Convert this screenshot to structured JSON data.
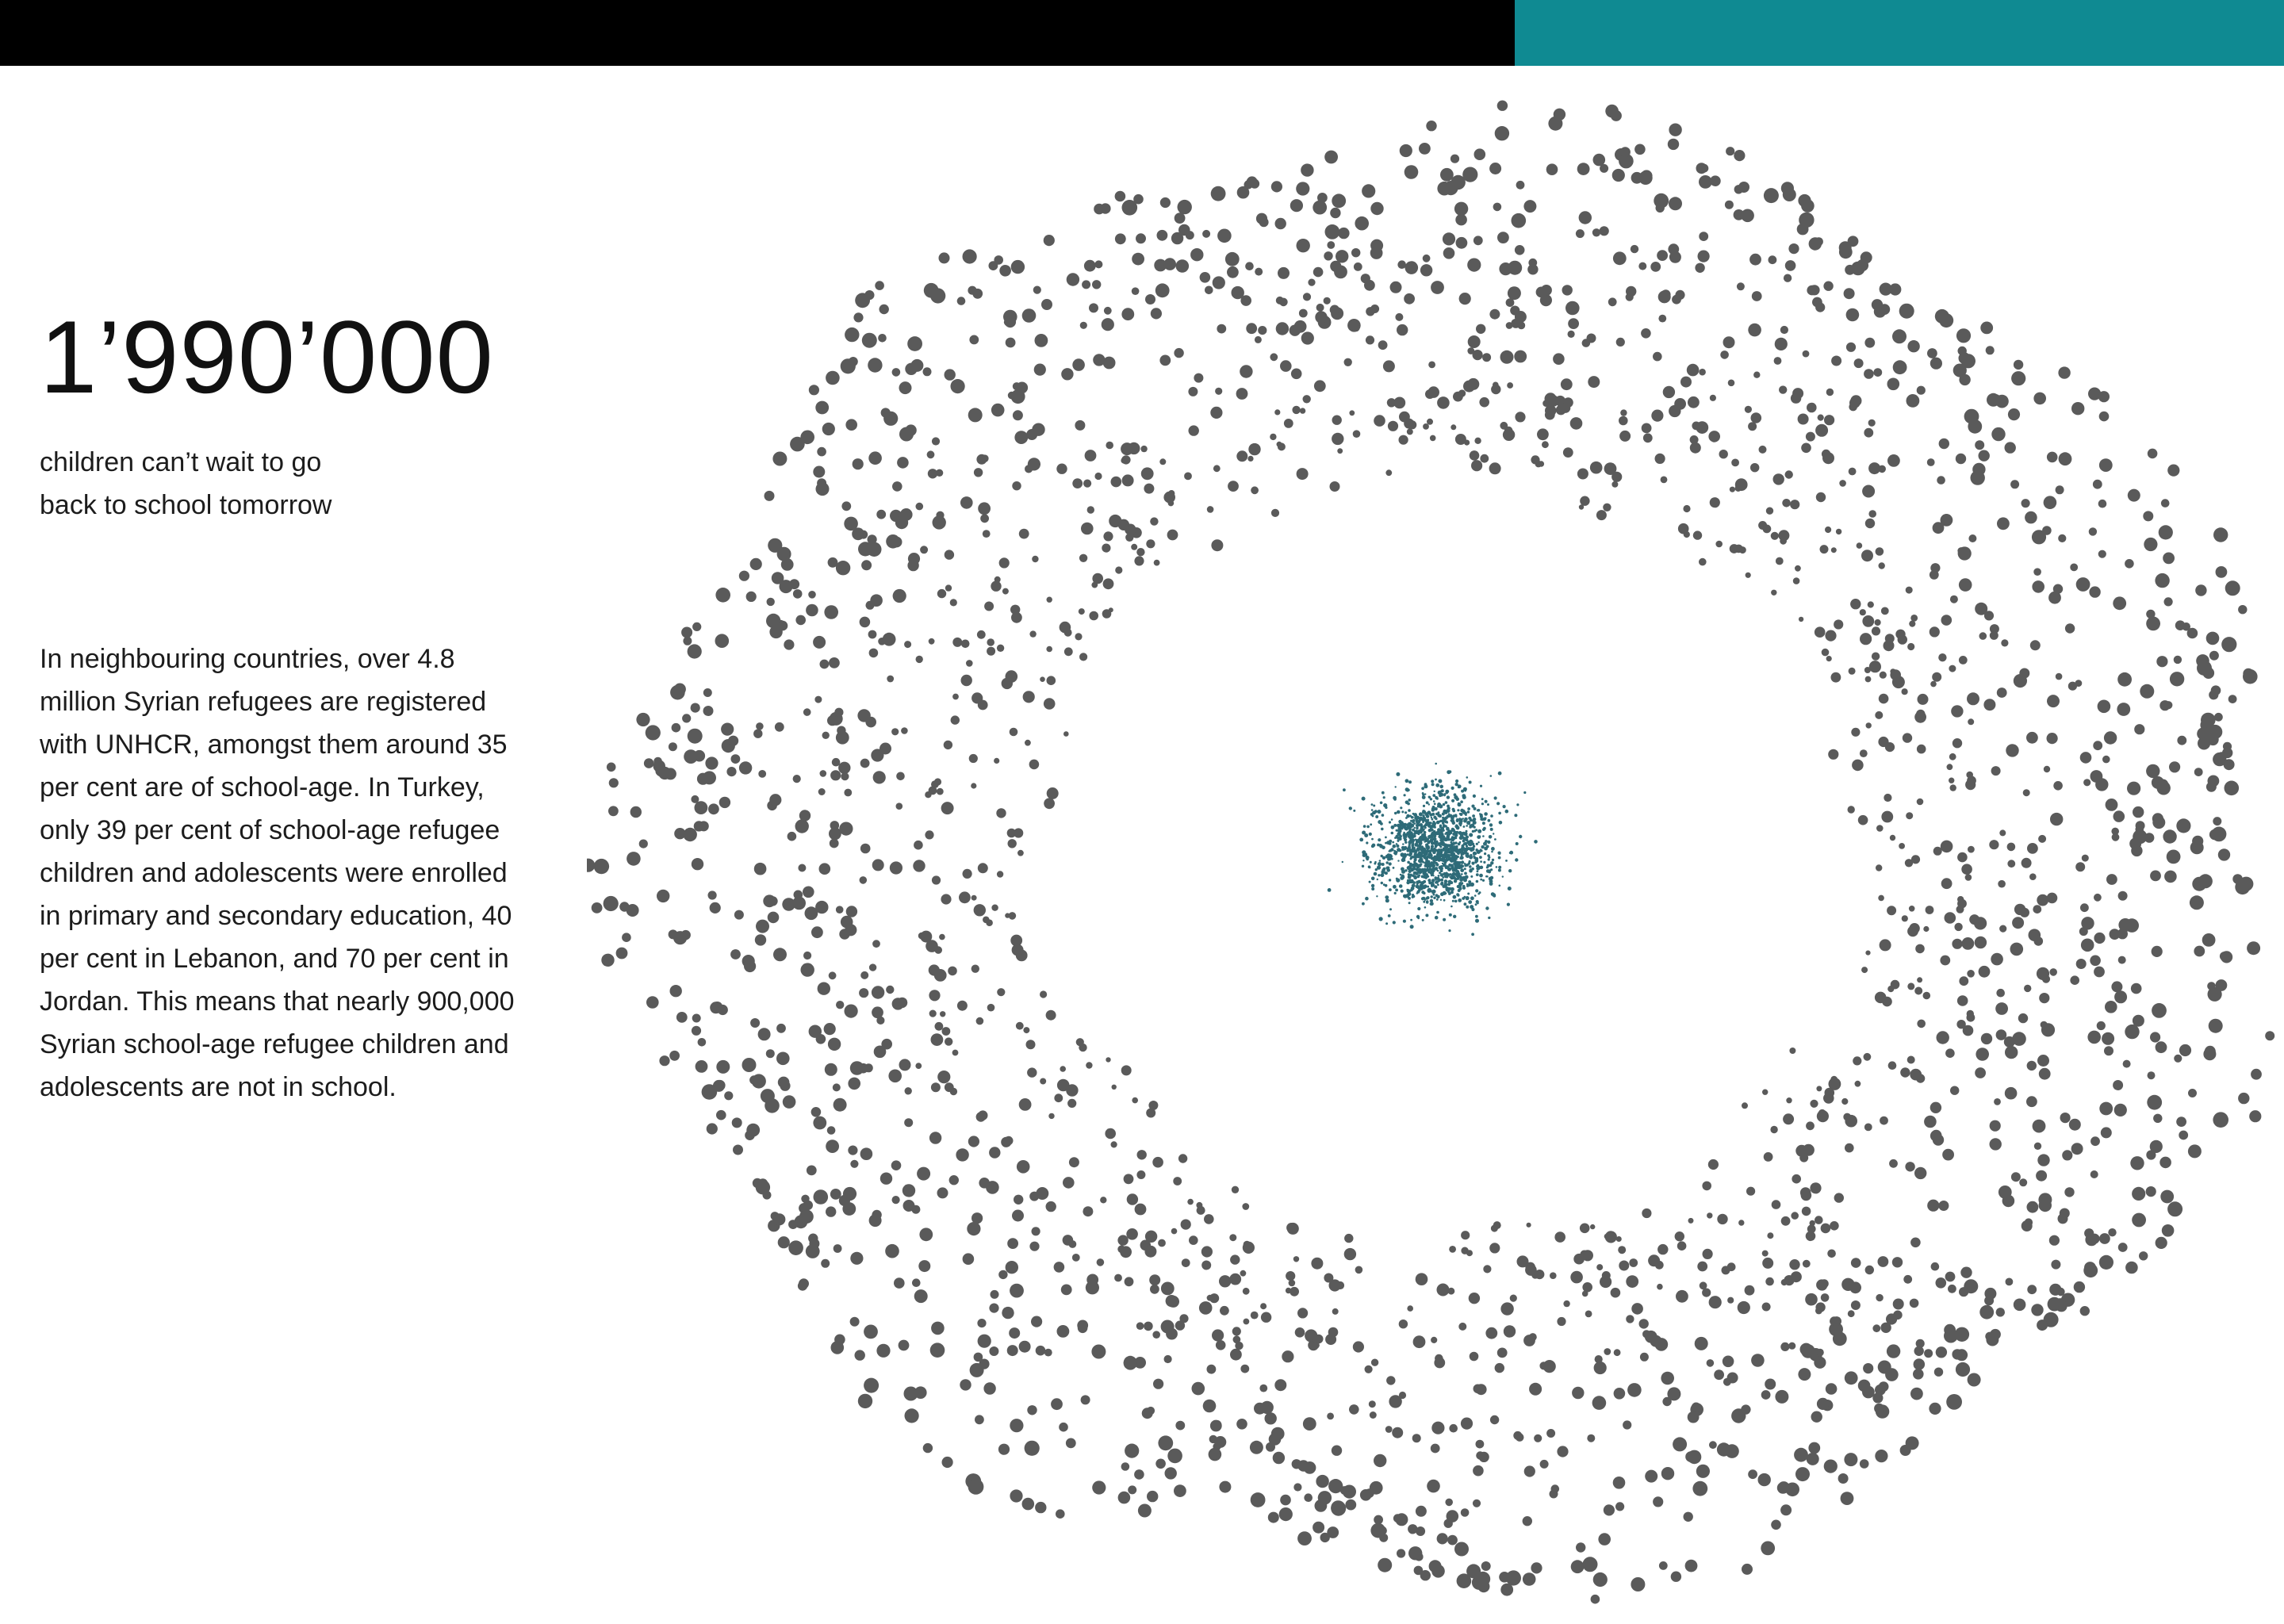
{
  "header": {
    "colors": {
      "bar_dark": "#000000",
      "bar_accent": "#0f8a92"
    }
  },
  "stat": {
    "number": "1’990’000",
    "caption_line1": "children can’t wait to go",
    "caption_line2": "back to school tomorrow"
  },
  "body": {
    "paragraph": "In neighbouring countries, over 4.8 million Syrian refugees are registered with UNHCR, amongst them around 35 per cent are of school-age. In Turkey, only 39 per cent of school-age refugee children and adolescents were enrolled in primary and secondary education, 40 per cent in Lebanon, and 70 per cent in Jordan. This means that nearly 900,000 Syrian school-age refugee children and adolescents are not in school."
  },
  "visualization": {
    "ring_color": "#5a5a5a",
    "core_color": "#2e6b78"
  }
}
